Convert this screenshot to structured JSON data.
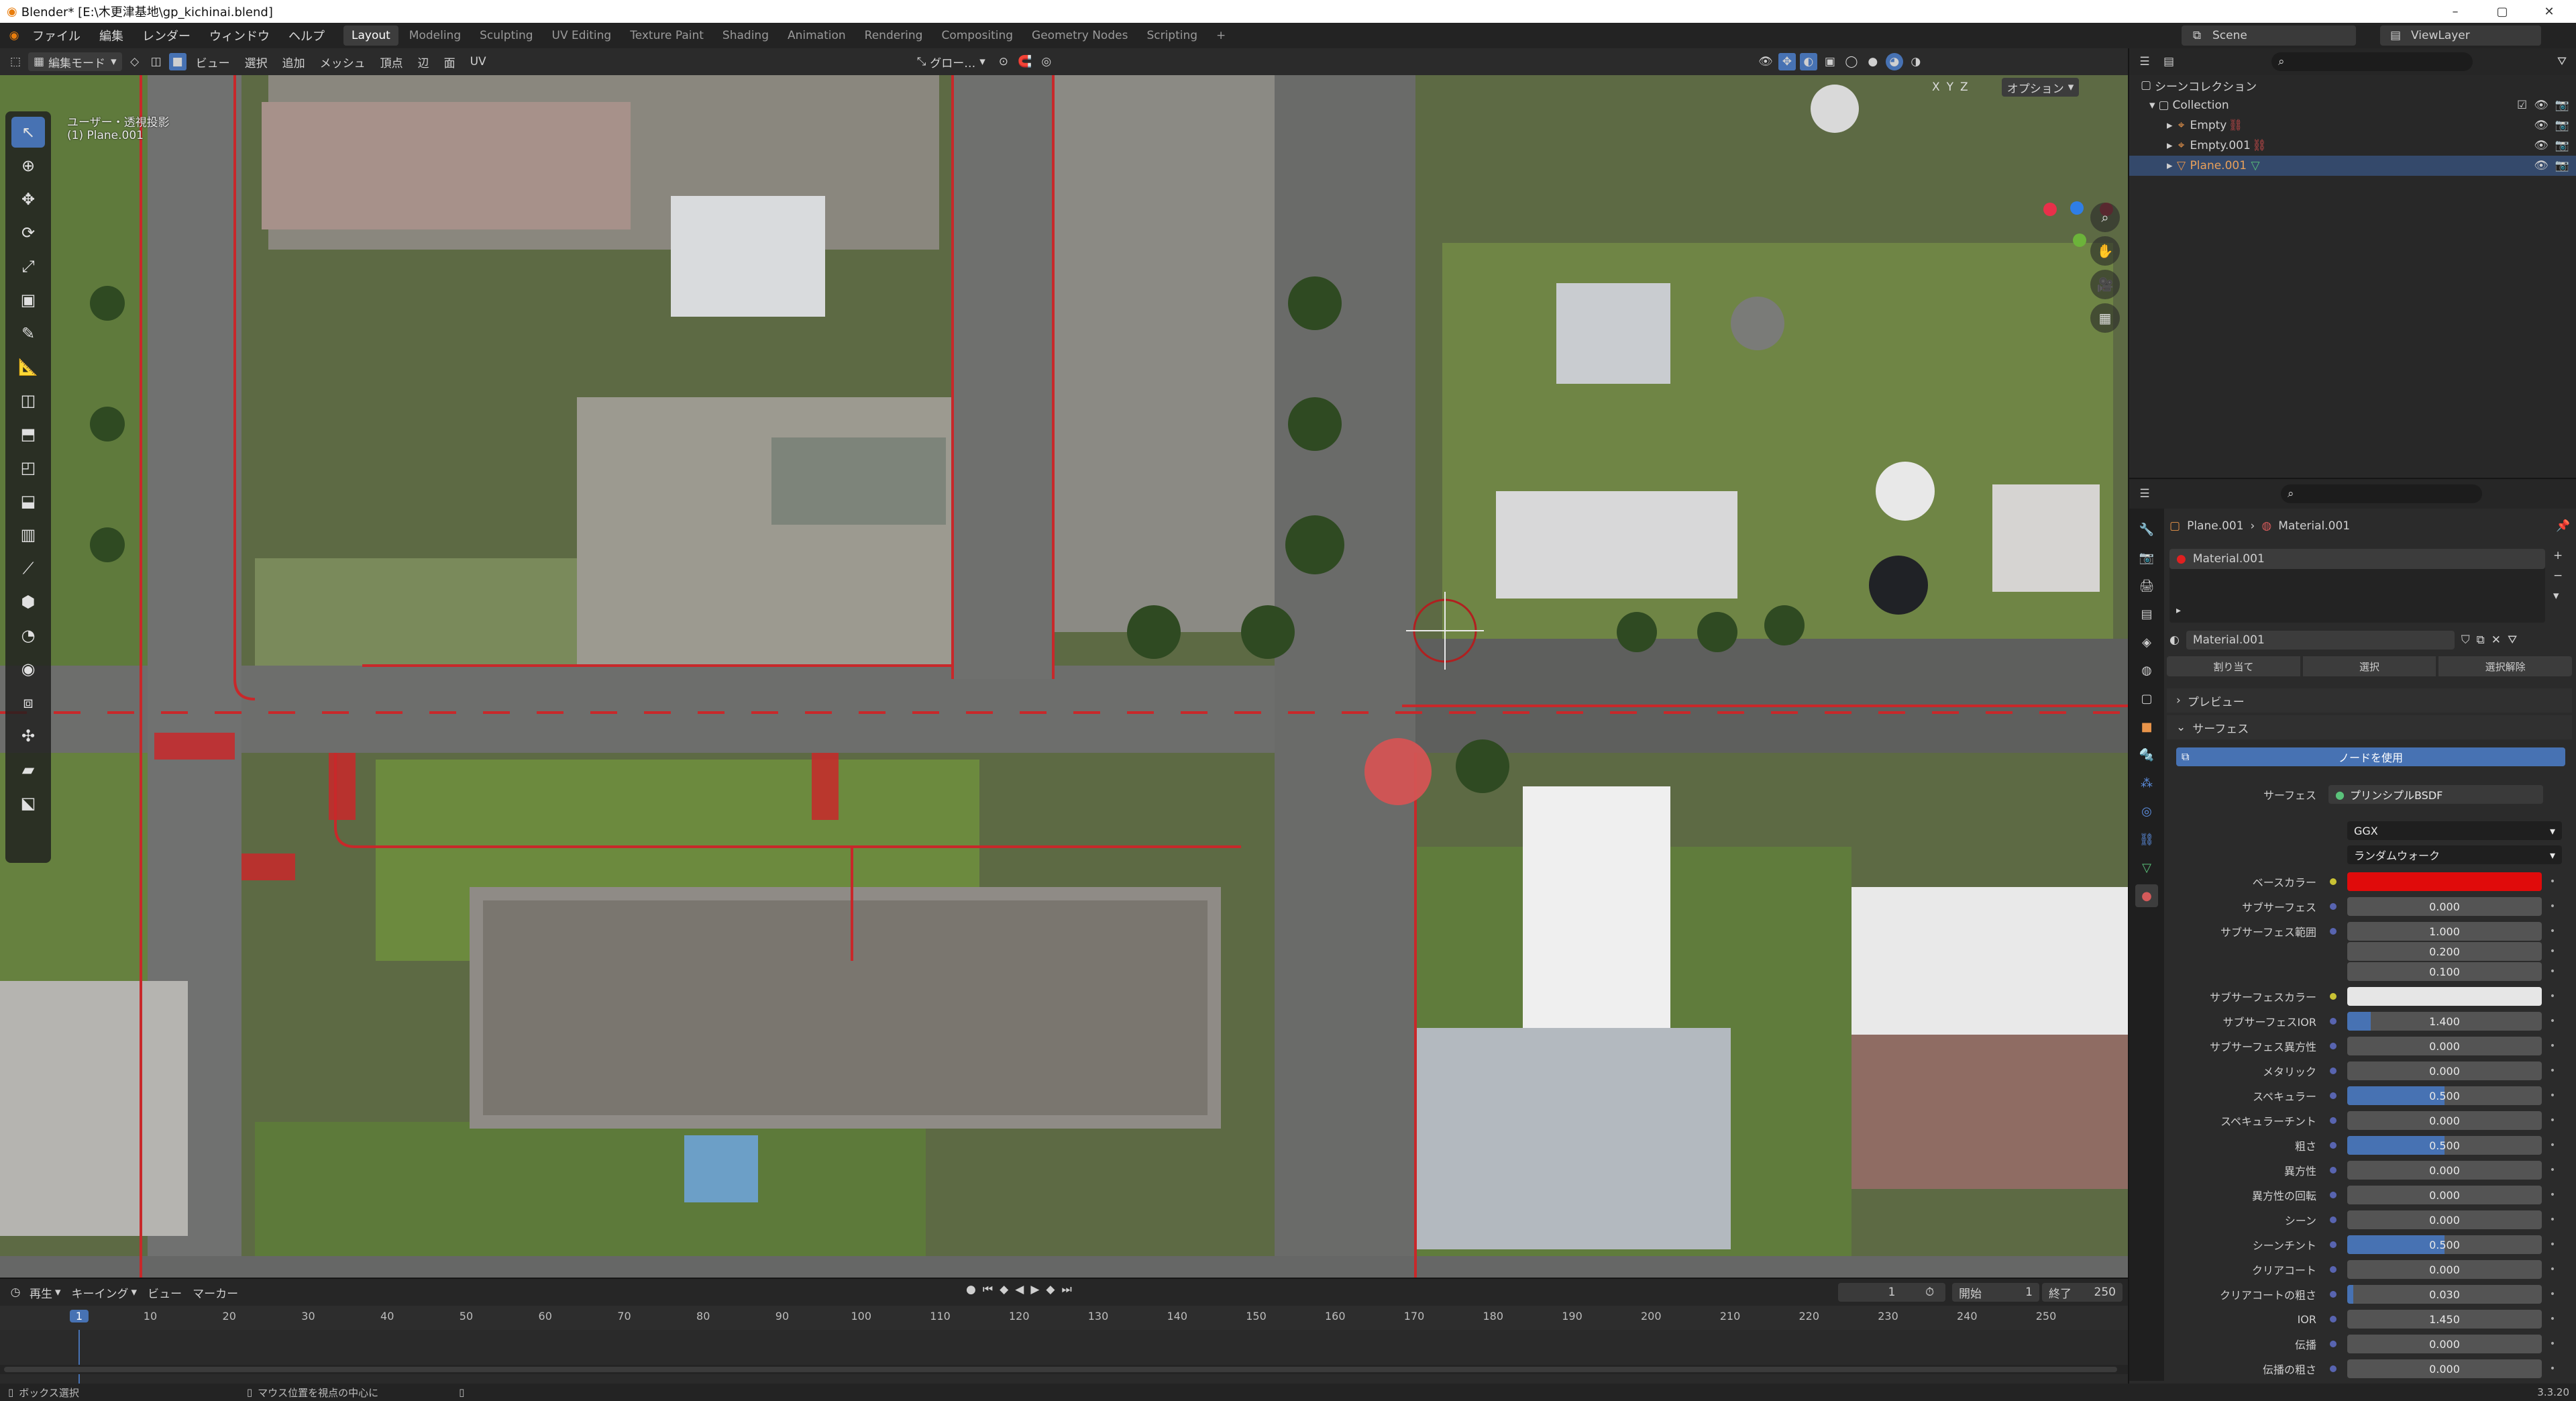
{
  "window": {
    "title": "Blender* [E:\\木更津基地\\gp_kichinai.blend]",
    "minimize": "–",
    "maximize": "▢",
    "close": "✕"
  },
  "menu": {
    "items": [
      "ファイル",
      "編集",
      "レンダー",
      "ウィンドウ",
      "ヘルプ"
    ]
  },
  "workspaces": {
    "tabs": [
      "Layout",
      "Modeling",
      "Sculpting",
      "UV Editing",
      "Texture Paint",
      "Shading",
      "Animation",
      "Rendering",
      "Compositing",
      "Geometry Nodes",
      "Scripting"
    ],
    "add": "+",
    "active": "Layout"
  },
  "scene": {
    "label": "Scene",
    "view_layer": "ViewLayer"
  },
  "viewport_header": {
    "mode": "編集モード",
    "menus": [
      "ビュー",
      "選択",
      "追加",
      "メッシュ",
      "頂点",
      "辺",
      "面",
      "UV"
    ],
    "transform": "グロー…",
    "options": "オプション",
    "axes": [
      "X",
      "Y",
      "Z"
    ]
  },
  "viewport": {
    "overlay_line1": "ユーザー・透視投影",
    "overlay_line2": "(1) Plane.001"
  },
  "outliner": {
    "root": "シーンコレクション",
    "collection": "Collection",
    "items": [
      {
        "name": "Empty"
      },
      {
        "name": "Empty.001"
      },
      {
        "name": "Plane.001",
        "selected": true
      }
    ]
  },
  "properties": {
    "breadcrumb_object": "Plane.001",
    "breadcrumb_material": "Material.001",
    "slot": "Material.001",
    "material_name": "Material.001",
    "buttons": [
      "割り当て",
      "選択",
      "選択解除"
    ],
    "preview_label": "プレビュー",
    "surface_section": "サーフェス",
    "use_nodes": "ノードを使用",
    "surface_label": "サーフェス",
    "shader": "プリンシプルBSDF",
    "distribution": "GGX",
    "subsurface_method": "ランダムウォーク",
    "rows": [
      {
        "label": "ベースカラー",
        "type": "color",
        "color": "#e00b0b",
        "dot": "yellow"
      },
      {
        "label": "サブサーフェス",
        "value": "0.000",
        "fill": 0
      },
      {
        "label": "サブサーフェス範囲",
        "value": "1.000",
        "fill": 0
      },
      {
        "label": "",
        "value": "0.200",
        "fill": 0
      },
      {
        "label": "",
        "value": "0.100",
        "fill": 0
      },
      {
        "label": "サブサーフェスカラー",
        "type": "color",
        "color": "#e6e6e6",
        "dot": "yellow"
      },
      {
        "label": "サブサーフェスIOR",
        "value": "1.400",
        "fill": 0.12
      },
      {
        "label": "サブサーフェス異方性",
        "value": "0.000",
        "fill": 0
      },
      {
        "label": "メタリック",
        "value": "0.000",
        "fill": 0
      },
      {
        "label": "スペキュラー",
        "value": "0.500",
        "fill": 0.5
      },
      {
        "label": "スペキュラーチント",
        "value": "0.000",
        "fill": 0
      },
      {
        "label": "粗さ",
        "value": "0.500",
        "fill": 0.5
      },
      {
        "label": "異方性",
        "value": "0.000",
        "fill": 0
      },
      {
        "label": "異方性の回転",
        "value": "0.000",
        "fill": 0
      },
      {
        "label": "シーン",
        "value": "0.000",
        "fill": 0
      },
      {
        "label": "シーンチント",
        "value": "0.500",
        "fill": 0.5
      },
      {
        "label": "クリアコート",
        "value": "0.000",
        "fill": 0
      },
      {
        "label": "クリアコートの粗さ",
        "value": "0.030",
        "fill": 0.03
      },
      {
        "label": "IOR",
        "value": "1.450",
        "fill": 0
      },
      {
        "label": "伝播",
        "value": "0.000",
        "fill": 0
      },
      {
        "label": "伝播の粗さ",
        "value": "0.000",
        "fill": 0
      }
    ]
  },
  "timeline": {
    "menus": [
      "再生",
      "キーイング",
      "ビュー",
      "マーカー"
    ],
    "current_frame": "1",
    "start_label": "開始",
    "start": "1",
    "end_label": "終了",
    "end": "250",
    "ticks": [
      "1",
      "10",
      "20",
      "30",
      "40",
      "50",
      "60",
      "70",
      "80",
      "90",
      "100",
      "110",
      "120",
      "130",
      "140",
      "150",
      "160",
      "170",
      "180",
      "190",
      "200",
      "210",
      "220",
      "230",
      "240",
      "250"
    ]
  },
  "statusbar": {
    "left": "ボックス選択",
    "middle": "マウス位置を視点の中心に",
    "version": "3.3.20"
  },
  "colors": {
    "accent": "#4772b3",
    "red_line": "#c8282a",
    "selected_row": "#34496b"
  }
}
